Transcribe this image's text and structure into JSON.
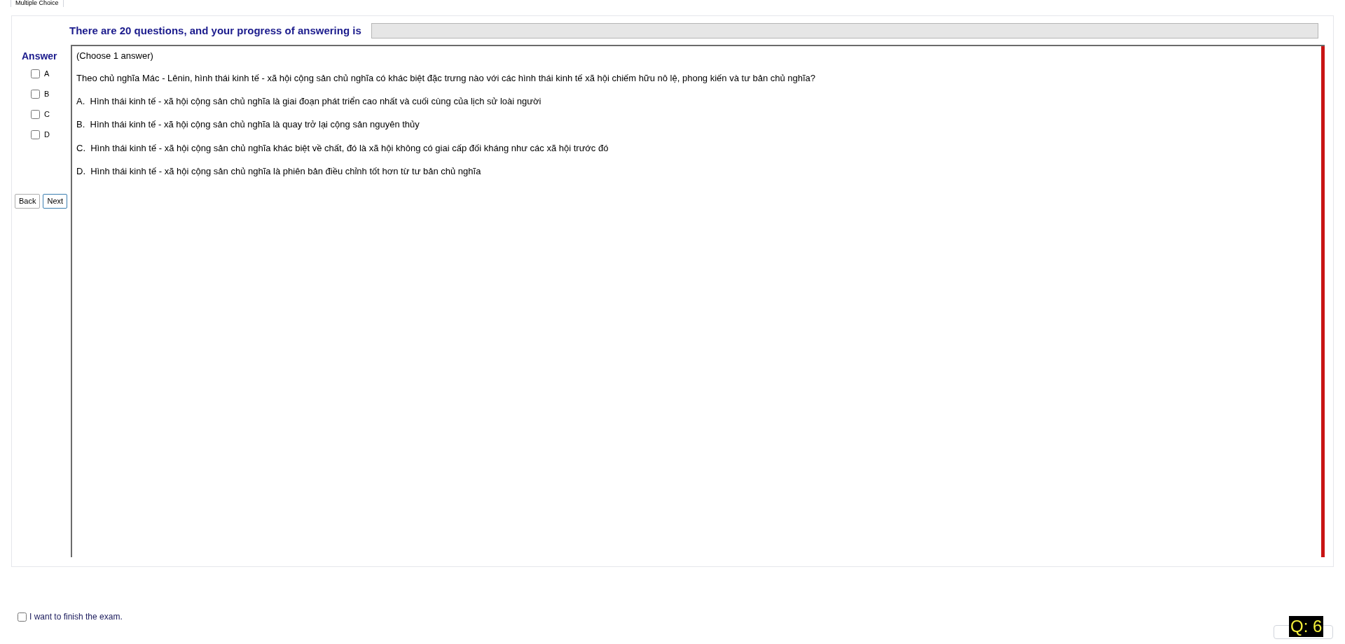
{
  "tabs": [
    {
      "label": "Multiple Choice",
      "selected": true
    }
  ],
  "progress": {
    "label": "There are 20 questions, and your progress of answering is",
    "level": 0
  },
  "answer_panel": {
    "title": "Answer",
    "options": [
      {
        "label": "A",
        "checked": false
      },
      {
        "label": "B",
        "checked": false
      },
      {
        "label": "C",
        "checked": false
      },
      {
        "label": "D",
        "checked": false
      }
    ]
  },
  "navigation": {
    "buttons": [
      {
        "label": "Back",
        "focused": false
      },
      {
        "label": "Next",
        "focused": true
      }
    ]
  },
  "question": {
    "instruction": "(Choose 1 answer)",
    "text": "Theo chủ nghĩa Mác - Lênin, hình thái kinh tế - xã hội cộng sản chủ nghĩa có khác biệt đặc trưng nào với các hình thái kinh tế xã hội chiếm hữu nô lệ, phong kiến và tư bản chủ nghĩa?",
    "choices": [
      "A.  Hình thái kinh tế - xã hội cộng sản chủ nghĩa là giai đoạn phát triển cao nhất và cuối cùng của lịch sử loài người",
      "B.  Hình thái kinh tế - xã hội cộng sản chủ nghĩa là quay trở lại cộng sản nguyên thủy",
      "C.  Hình thái kinh tế - xã hội cộng sản chủ nghĩa khác biệt về chất, đó là xã hội không có giai cấp đối kháng như các xã hội trước đó",
      "D.  Hình thái kinh tế - xã hội cộng sản chủ nghĩa là phiên bản điều chỉnh tốt hơn từ tư bản chủ nghĩa"
    ]
  },
  "finish": {
    "label": "I want to finish the exam.",
    "checked": false
  },
  "question_counter": "Q: 6"
}
